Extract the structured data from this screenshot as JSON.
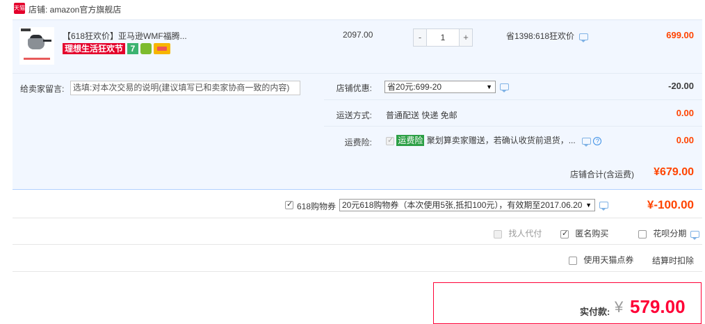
{
  "shop": {
    "icon_text": "天猫",
    "label": "店铺: amazon官方旗舰店"
  },
  "item": {
    "title": "【618狂欢价】亚马逊WMF福腾...",
    "promo_badge": "理想生活狂欢节",
    "badge_7": "7",
    "unit_price": "2097.00",
    "quantity": "1",
    "qty_minus": "-",
    "qty_plus": "+",
    "saving": "省1398:618狂欢价",
    "total": "699.00"
  },
  "memo": {
    "label": "给卖家留言:",
    "placeholder": "选填:对本次交易的说明(建议填写已和卖家协商一致的内容)"
  },
  "discount": {
    "label": "店铺优惠:",
    "selected": "省20元:699-20",
    "value": "-20.00"
  },
  "shipping": {
    "label": "运送方式:",
    "method": "普通配送 快递 免邮",
    "value": "0.00"
  },
  "insurance": {
    "label": "运费险:",
    "tag": "运费险",
    "text": "聚划算卖家赠送，若确认收货前退货，...",
    "help": "?",
    "value": "0.00"
  },
  "shop_total": {
    "label": "店铺合计(含运费)",
    "value": "¥679.00"
  },
  "coupon": {
    "label": "618购物券",
    "selected": "20元618购物券（本次使用5张,抵扣100元），有效期至2017.06.20",
    "value": "¥-100.00"
  },
  "options": {
    "proxy": "找人代付",
    "anonymous": "匿名购买",
    "installment": "花呗分期",
    "tmall_points": "使用天猫点券",
    "settlement": "结算时扣除"
  },
  "payment": {
    "label": "实付款:",
    "currency": "¥",
    "value": "579.00"
  },
  "colors": {
    "price_red": "#ff4400",
    "pay_red": "#ff0036",
    "panel_bg": "#f2f7ff",
    "insurance_green": "#2c9f45"
  }
}
